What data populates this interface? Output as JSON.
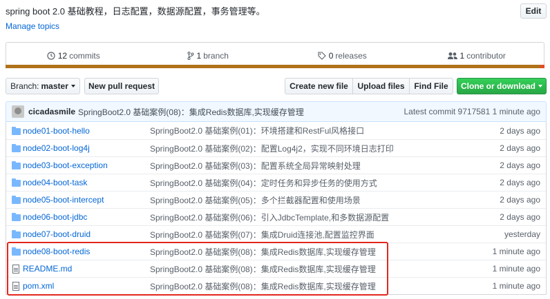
{
  "repo": {
    "description": "spring boot 2.0 基础教程，日志配置，数据源配置，事务管理等。",
    "edit_label": "Edit",
    "manage_topics": "Manage topics"
  },
  "summary": {
    "commits_count": "12",
    "commits_label": "commits",
    "branch_count": "1",
    "branch_label": "branch",
    "releases_count": "0",
    "releases_label": "releases",
    "contributor_count": "1",
    "contributor_label": "contributor"
  },
  "language_colors": [
    "#b07219",
    "#e34c26"
  ],
  "toolbar": {
    "branch_prefix": "Branch:",
    "branch_name": "master",
    "new_pull_request": "New pull request",
    "create_new_file": "Create new file",
    "upload_files": "Upload files",
    "find_file": "Find File",
    "clone_or_download": "Clone or download"
  },
  "latest_commit": {
    "author": "cicadasmile",
    "message": "SpringBoot2.0 基础案例(08)：集成Redis数据库,实现缓存管理",
    "label": "Latest commit",
    "hash": "9717581",
    "time": "1 minute ago"
  },
  "files": [
    {
      "type": "folder",
      "icon": "folder-icon",
      "name": "node01-boot-hello",
      "message": "SpringBoot2.0 基础案例(01)：环境搭建和RestFul风格接口",
      "age": "2 days ago"
    },
    {
      "type": "folder",
      "icon": "folder-icon",
      "name": "node02-boot-log4j",
      "message": "SpringBoot2.0 基础案例(02)：配置Log4j2，实现不同环境日志打印",
      "age": "2 days ago"
    },
    {
      "type": "folder",
      "icon": "folder-icon",
      "name": "node03-boot-exception",
      "message": "SpringBoot2.0 基础案例(03)：配置系统全局异常映射处理",
      "age": "2 days ago"
    },
    {
      "type": "folder",
      "icon": "folder-icon",
      "name": "node04-boot-task",
      "message": "SpringBoot2.0 基础案例(04)：定时任务和异步任务的使用方式",
      "age": "2 days ago"
    },
    {
      "type": "folder",
      "icon": "folder-icon",
      "name": "node05-boot-intercept",
      "message": "SpringBoot2.0 基础案例(05)：多个拦截器配置和使用场景",
      "age": "2 days ago"
    },
    {
      "type": "folder",
      "icon": "folder-icon",
      "name": "node06-boot-jdbc",
      "message": "SpringBoot2.0 基础案例(06)：引入JdbcTemplate,和多数据源配置",
      "age": "2 days ago"
    },
    {
      "type": "folder",
      "icon": "folder-icon",
      "name": "node07-boot-druid",
      "message": "SpringBoot2.0 基础案例(07)：集成Druid连接池,配置监控界面",
      "age": "yesterday"
    },
    {
      "type": "folder",
      "icon": "folder-icon",
      "name": "node08-boot-redis",
      "message": "SpringBoot2.0 基础案例(08)：集成Redis数据库,实现缓存管理",
      "age": "1 minute ago"
    },
    {
      "type": "file",
      "icon": "file-icon",
      "name": "README.md",
      "message": "SpringBoot2.0 基础案例(08)：集成Redis数据库,实现缓存管理",
      "age": "1 minute ago"
    },
    {
      "type": "file",
      "icon": "file-icon",
      "name": "pom.xml",
      "message": "SpringBoot2.0 基础案例(08)：集成Redis数据库,实现缓存管理",
      "age": "1 minute ago"
    }
  ],
  "highlight_color": "#e2261c"
}
